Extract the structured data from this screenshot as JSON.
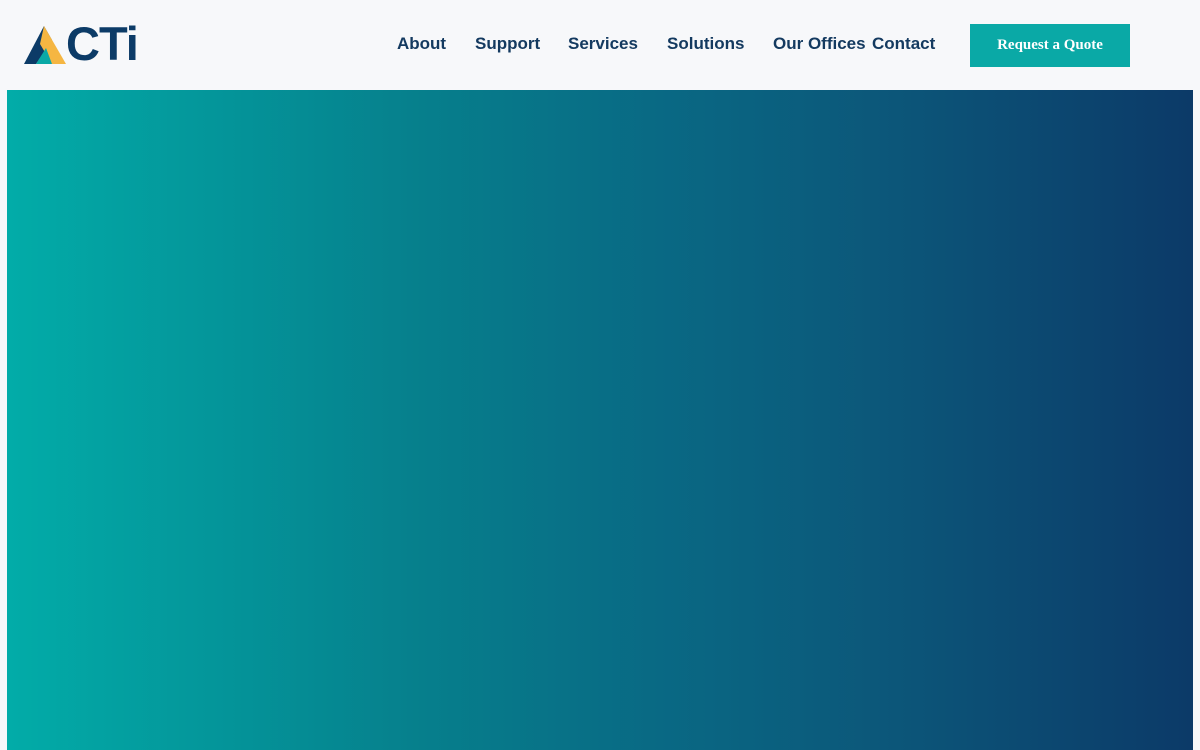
{
  "brand": {
    "logo_text": "CTi",
    "colors": {
      "primary_navy": "#0c3b67",
      "teal": "#0aa9a6",
      "accent_yellow": "#f5b642"
    }
  },
  "nav": {
    "items": [
      {
        "label": "About"
      },
      {
        "label": "Support"
      },
      {
        "label": "Services"
      },
      {
        "label": "Solutions"
      },
      {
        "label": "Our Offices"
      },
      {
        "label": "Contact"
      }
    ],
    "cta_label": "Request a Quote"
  },
  "hero": {
    "gradient_start": "#02aca8",
    "gradient_end": "#0c3a68"
  }
}
